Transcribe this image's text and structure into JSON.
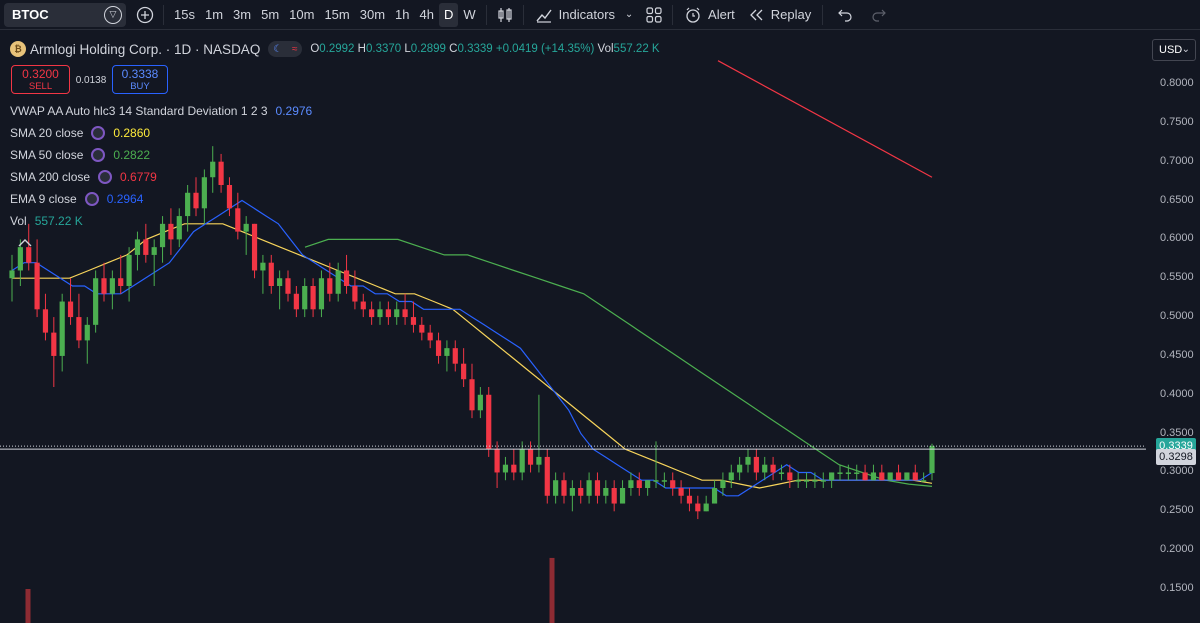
{
  "toolbar": {
    "symbol": "BTOC",
    "timeframes": [
      "15s",
      "1m",
      "3m",
      "5m",
      "10m",
      "15m",
      "30m",
      "1h",
      "4h",
      "D",
      "W"
    ],
    "active_timeframe": "D",
    "indicators_label": "Indicators",
    "alert_label": "Alert",
    "replay_label": "Replay"
  },
  "legend": {
    "title": "Armlogi Holding Corp. · 1D · NASDAQ",
    "open_key": "O",
    "open": "0.2992",
    "high_key": "H",
    "high": "0.3370",
    "low_key": "L",
    "low": "0.2899",
    "close_key": "C",
    "close": "0.3339",
    "change": "+0.0419 (+14.35%)",
    "vol_key": "Vol",
    "vol": "557.22 K"
  },
  "trade": {
    "sell_price": "0.3200",
    "sell_label": "SELL",
    "spread": "0.0138",
    "buy_price": "0.3338",
    "buy_label": "BUY"
  },
  "indicators": [
    {
      "name": "VWAP AA Auto hlc3 14 Standard Deviation 1 2 3",
      "value": "0.2976",
      "color": "#5b8bff"
    },
    {
      "name": "SMA 20 close",
      "value": "0.2860",
      "color": "#ffeb3b"
    },
    {
      "name": "SMA 50 close",
      "value": "0.2822",
      "color": "#4caf50"
    },
    {
      "name": "SMA 200 close",
      "value": "0.6779",
      "color": "#f23645"
    },
    {
      "name": "EMA 9 close",
      "value": "0.2964",
      "color": "#2962ff"
    },
    {
      "name": "Vol",
      "value": "557.22 K",
      "color": "#26a69a"
    }
  ],
  "axis": {
    "currency": "USD",
    "ticks": [
      "0.8000",
      "0.7500",
      "0.7000",
      "0.6500",
      "0.6000",
      "0.5500",
      "0.5000",
      "0.4500",
      "0.4000",
      "0.3500",
      "0.3000",
      "0.2500",
      "0.2000",
      "0.1500"
    ],
    "last_price": "0.3339",
    "prev_price": "0.3298"
  },
  "colors": {
    "up": "#26a69a",
    "up_candle": "#4caf50",
    "down": "#f23645",
    "sma20": "#f7d45b",
    "sma50": "#4caf50",
    "sma200": "#f23645",
    "ema9": "#2962ff",
    "background": "#131722"
  },
  "chart_data": {
    "type": "candlestick",
    "ylim": [
      0.13,
      0.84
    ],
    "candles": [
      [
        0.55,
        0.58,
        0.52,
        0.56
      ],
      [
        0.56,
        0.6,
        0.54,
        0.59
      ],
      [
        0.59,
        0.62,
        0.56,
        0.57
      ],
      [
        0.57,
        0.6,
        0.5,
        0.51
      ],
      [
        0.51,
        0.53,
        0.47,
        0.48
      ],
      [
        0.48,
        0.5,
        0.41,
        0.45
      ],
      [
        0.45,
        0.53,
        0.43,
        0.52
      ],
      [
        0.52,
        0.55,
        0.49,
        0.5
      ],
      [
        0.5,
        0.53,
        0.46,
        0.47
      ],
      [
        0.47,
        0.5,
        0.44,
        0.49
      ],
      [
        0.49,
        0.56,
        0.48,
        0.55
      ],
      [
        0.55,
        0.57,
        0.52,
        0.53
      ],
      [
        0.53,
        0.56,
        0.51,
        0.55
      ],
      [
        0.55,
        0.58,
        0.53,
        0.54
      ],
      [
        0.54,
        0.59,
        0.52,
        0.58
      ],
      [
        0.58,
        0.61,
        0.56,
        0.6
      ],
      [
        0.6,
        0.62,
        0.57,
        0.58
      ],
      [
        0.58,
        0.6,
        0.54,
        0.59
      ],
      [
        0.59,
        0.63,
        0.57,
        0.62
      ],
      [
        0.62,
        0.64,
        0.58,
        0.6
      ],
      [
        0.6,
        0.64,
        0.59,
        0.63
      ],
      [
        0.63,
        0.67,
        0.61,
        0.66
      ],
      [
        0.66,
        0.68,
        0.63,
        0.64
      ],
      [
        0.64,
        0.69,
        0.62,
        0.68
      ],
      [
        0.68,
        0.72,
        0.66,
        0.7
      ],
      [
        0.7,
        0.71,
        0.66,
        0.67
      ],
      [
        0.67,
        0.68,
        0.63,
        0.64
      ],
      [
        0.64,
        0.66,
        0.6,
        0.61
      ],
      [
        0.61,
        0.63,
        0.58,
        0.62
      ],
      [
        0.62,
        0.62,
        0.55,
        0.56
      ],
      [
        0.56,
        0.58,
        0.53,
        0.57
      ],
      [
        0.57,
        0.58,
        0.53,
        0.54
      ],
      [
        0.54,
        0.56,
        0.51,
        0.55
      ],
      [
        0.55,
        0.56,
        0.52,
        0.53
      ],
      [
        0.53,
        0.54,
        0.5,
        0.51
      ],
      [
        0.51,
        0.55,
        0.5,
        0.54
      ],
      [
        0.54,
        0.55,
        0.5,
        0.51
      ],
      [
        0.51,
        0.56,
        0.5,
        0.55
      ],
      [
        0.55,
        0.57,
        0.52,
        0.53
      ],
      [
        0.53,
        0.57,
        0.52,
        0.56
      ],
      [
        0.56,
        0.58,
        0.53,
        0.54
      ],
      [
        0.54,
        0.56,
        0.51,
        0.52
      ],
      [
        0.52,
        0.53,
        0.5,
        0.51
      ],
      [
        0.51,
        0.52,
        0.49,
        0.5
      ],
      [
        0.5,
        0.52,
        0.49,
        0.51
      ],
      [
        0.51,
        0.52,
        0.49,
        0.5
      ],
      [
        0.5,
        0.52,
        0.49,
        0.51
      ],
      [
        0.51,
        0.53,
        0.49,
        0.5
      ],
      [
        0.5,
        0.52,
        0.48,
        0.49
      ],
      [
        0.49,
        0.5,
        0.47,
        0.48
      ],
      [
        0.48,
        0.49,
        0.46,
        0.47
      ],
      [
        0.47,
        0.48,
        0.44,
        0.45
      ],
      [
        0.45,
        0.47,
        0.43,
        0.46
      ],
      [
        0.46,
        0.47,
        0.43,
        0.44
      ],
      [
        0.44,
        0.46,
        0.41,
        0.42
      ],
      [
        0.42,
        0.44,
        0.37,
        0.38
      ],
      [
        0.38,
        0.41,
        0.37,
        0.4
      ],
      [
        0.4,
        0.41,
        0.32,
        0.33
      ],
      [
        0.33,
        0.34,
        0.28,
        0.3
      ],
      [
        0.3,
        0.32,
        0.29,
        0.31
      ],
      [
        0.31,
        0.33,
        0.29,
        0.3
      ],
      [
        0.3,
        0.34,
        0.29,
        0.33
      ],
      [
        0.33,
        0.34,
        0.3,
        0.31
      ],
      [
        0.31,
        0.4,
        0.3,
        0.32
      ],
      [
        0.32,
        0.33,
        0.26,
        0.27
      ],
      [
        0.27,
        0.3,
        0.26,
        0.29
      ],
      [
        0.29,
        0.3,
        0.26,
        0.27
      ],
      [
        0.27,
        0.29,
        0.25,
        0.28
      ],
      [
        0.28,
        0.29,
        0.26,
        0.27
      ],
      [
        0.27,
        0.3,
        0.26,
        0.29
      ],
      [
        0.29,
        0.3,
        0.26,
        0.27
      ],
      [
        0.27,
        0.29,
        0.26,
        0.28
      ],
      [
        0.28,
        0.29,
        0.25,
        0.26
      ],
      [
        0.26,
        0.29,
        0.26,
        0.28
      ],
      [
        0.28,
        0.3,
        0.27,
        0.29
      ],
      [
        0.29,
        0.3,
        0.27,
        0.28
      ],
      [
        0.28,
        0.29,
        0.27,
        0.29
      ],
      [
        0.29,
        0.34,
        0.28,
        0.29
      ],
      [
        0.29,
        0.3,
        0.28,
        0.29
      ],
      [
        0.29,
        0.3,
        0.27,
        0.28
      ],
      [
        0.28,
        0.29,
        0.26,
        0.27
      ],
      [
        0.27,
        0.28,
        0.25,
        0.26
      ],
      [
        0.26,
        0.27,
        0.24,
        0.25
      ],
      [
        0.25,
        0.27,
        0.25,
        0.26
      ],
      [
        0.26,
        0.29,
        0.26,
        0.28
      ],
      [
        0.28,
        0.3,
        0.27,
        0.29
      ],
      [
        0.29,
        0.31,
        0.28,
        0.3
      ],
      [
        0.3,
        0.32,
        0.29,
        0.31
      ],
      [
        0.31,
        0.33,
        0.3,
        0.32
      ],
      [
        0.32,
        0.33,
        0.29,
        0.3
      ],
      [
        0.3,
        0.32,
        0.29,
        0.31
      ],
      [
        0.31,
        0.32,
        0.29,
        0.3
      ],
      [
        0.3,
        0.31,
        0.29,
        0.3
      ],
      [
        0.3,
        0.31,
        0.28,
        0.29
      ],
      [
        0.29,
        0.3,
        0.28,
        0.29
      ],
      [
        0.29,
        0.3,
        0.28,
        0.29
      ],
      [
        0.29,
        0.3,
        0.28,
        0.29
      ],
      [
        0.29,
        0.3,
        0.28,
        0.29
      ],
      [
        0.29,
        0.3,
        0.28,
        0.3
      ],
      [
        0.3,
        0.31,
        0.29,
        0.3
      ],
      [
        0.3,
        0.31,
        0.29,
        0.3
      ],
      [
        0.3,
        0.31,
        0.29,
        0.3
      ],
      [
        0.3,
        0.31,
        0.29,
        0.29
      ],
      [
        0.29,
        0.31,
        0.29,
        0.3
      ],
      [
        0.3,
        0.31,
        0.29,
        0.29
      ],
      [
        0.29,
        0.3,
        0.29,
        0.3
      ],
      [
        0.3,
        0.31,
        0.29,
        0.29
      ],
      [
        0.29,
        0.3,
        0.29,
        0.3
      ],
      [
        0.3,
        0.31,
        0.29,
        0.29
      ],
      [
        0.29,
        0.3,
        0.29,
        0.29
      ],
      [
        0.2992,
        0.337,
        0.2899,
        0.3339
      ]
    ],
    "ema9": [
      0.56,
      0.57,
      0.57,
      0.56,
      0.55,
      0.54,
      0.54,
      0.53,
      0.53,
      0.53,
      0.54,
      0.55,
      0.56,
      0.57,
      0.59,
      0.61,
      0.62,
      0.63,
      0.64,
      0.65,
      0.64,
      0.63,
      0.62,
      0.6,
      0.58,
      0.57,
      0.56,
      0.55,
      0.54,
      0.54,
      0.53,
      0.53,
      0.52,
      0.52,
      0.51,
      0.51,
      0.51,
      0.51,
      0.5,
      0.49,
      0.48,
      0.47,
      0.46,
      0.44,
      0.42,
      0.4,
      0.38,
      0.35,
      0.33,
      0.32,
      0.31,
      0.3,
      0.29,
      0.29,
      0.28,
      0.28,
      0.28,
      0.28,
      0.28,
      0.27,
      0.27,
      0.28,
      0.29,
      0.3,
      0.31,
      0.3,
      0.3,
      0.29,
      0.29,
      0.29,
      0.29,
      0.29,
      0.29,
      0.29,
      0.29,
      0.29,
      0.3
    ],
    "sma20": [
      0.55,
      0.55,
      0.55,
      0.55,
      0.56,
      0.57,
      0.58,
      0.6,
      0.61,
      0.62,
      0.62,
      0.62,
      0.61,
      0.6,
      0.59,
      0.58,
      0.57,
      0.56,
      0.55,
      0.54,
      0.53,
      0.53,
      0.52,
      0.51,
      0.49,
      0.47,
      0.45,
      0.43,
      0.41,
      0.39,
      0.37,
      0.35,
      0.33,
      0.32,
      0.31,
      0.3,
      0.29,
      0.29,
      0.285,
      0.28,
      0.285,
      0.29,
      0.29,
      0.29,
      0.29,
      0.29,
      0.29,
      0.29,
      0.286
    ],
    "sma50": [
      0.59,
      0.6,
      0.6,
      0.6,
      0.6,
      0.59,
      0.58,
      0.58,
      0.57,
      0.56,
      0.55,
      0.54,
      0.53,
      0.51,
      0.49,
      0.47,
      0.45,
      0.43,
      0.41,
      0.39,
      0.37,
      0.35,
      0.33,
      0.31,
      0.3,
      0.29,
      0.285,
      0.282
    ],
    "sma200": [
      0.83,
      0.68
    ],
    "volume_spikes": [
      0.15,
      0.19
    ]
  }
}
